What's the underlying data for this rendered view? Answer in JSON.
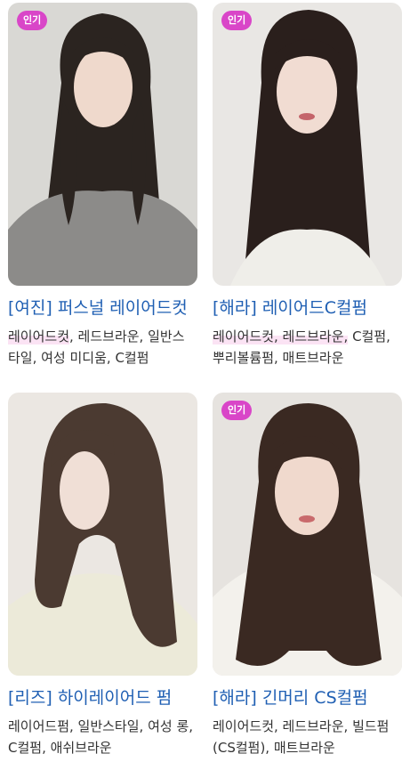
{
  "cards": [
    {
      "badge": "인기",
      "title": "[여진] 퍼스널 레이어드컷",
      "tags_hl": "레이어드컷",
      "tags_rest": ", 레드브라운, 일반스타일, 여성 미디움, C컬펌",
      "colors": {
        "bg": "#d9d8d4",
        "hair": "#2b2420",
        "skin": "#efd9cc",
        "cloth": "#8c8b89"
      }
    },
    {
      "badge": "인기",
      "title": "[해라] 레이어드C컬펌",
      "tags_hl": "레이어드컷, 레드브라운,",
      "tags_rest": " C컬펌, 뿌리볼륨펌, 매트브라운",
      "colors": {
        "bg": "#e9e7e4",
        "hair": "#2a1f1c",
        "skin": "#f1dcd2",
        "cloth": "#efeee9"
      }
    },
    {
      "badge": "",
      "title": "[리즈] 하이레이어드 펌",
      "tags_hl": "",
      "tags_rest": "레이어드펌, 일반스타일, 여성 롱, C컬펌, 애쉬브라운",
      "colors": {
        "bg": "#ebe7e2",
        "hair": "#4b3a31",
        "skin": "#f0dfd6",
        "cloth": "#ecead9"
      }
    },
    {
      "badge": "인기",
      "title": "[해라] 긴머리 CS컬펌",
      "tags_hl": "",
      "tags_rest": "레이어드컷, 레드브라운, 빌드펌(CS컬펌), 매트브라운",
      "colors": {
        "bg": "#e6e3df",
        "hair": "#3a2922",
        "skin": "#f0d9cd",
        "cloth": "#f3f1ec"
      }
    }
  ]
}
